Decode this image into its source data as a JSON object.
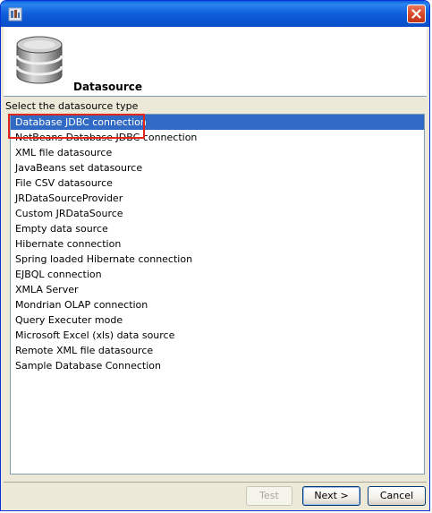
{
  "header": {
    "title": "Datasource"
  },
  "instruction": "Select the datasource type",
  "datasource_types": [
    "Database JDBC connection",
    "NetBeans Database JDBC connection",
    "XML file datasource",
    "JavaBeans set datasource",
    "File CSV datasource",
    "JRDataSourceProvider",
    "Custom JRDataSource",
    "Empty data source",
    "Hibernate connection",
    "Spring loaded Hibernate connection",
    "EJBQL connection",
    "XMLA Server",
    "Mondrian OLAP connection",
    "Query Executer mode",
    "Microsoft Excel (xls) data source",
    "Remote XML file datasource",
    "Sample Database Connection"
  ],
  "selected_index": 0,
  "buttons": {
    "test": "Test",
    "next": "Next >",
    "cancel": "Cancel"
  },
  "colors": {
    "selection": "#316ac5",
    "highlight_box": "#e1261c",
    "titlebar": "#0a5fdc"
  },
  "icons": {
    "app": "app-icon",
    "header": "database-icon",
    "close": "close-icon"
  }
}
